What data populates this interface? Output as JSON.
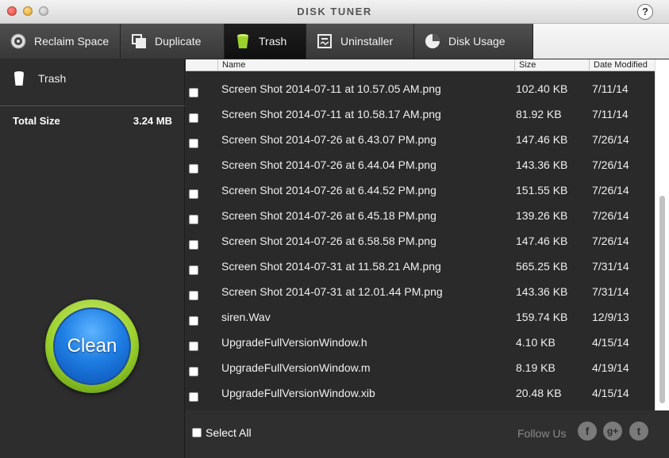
{
  "window": {
    "title": "DISK TUNER",
    "help_label": "?"
  },
  "tabs": [
    {
      "label": "Reclaim Space",
      "icon": "reclaim-icon"
    },
    {
      "label": "Duplicate",
      "icon": "duplicate-icon"
    },
    {
      "label": "Trash",
      "icon": "trash-icon",
      "active": true
    },
    {
      "label": "Uninstaller",
      "icon": "uninstaller-icon"
    },
    {
      "label": "Disk Usage",
      "icon": "disk-usage-icon"
    }
  ],
  "sidebar": {
    "trash_label": "Trash",
    "total_label": "Total Size",
    "total_value": "3.24 MB",
    "clean_label": "Clean"
  },
  "list": {
    "columns": {
      "name": "Name",
      "size": "Size",
      "date": "Date Modified"
    },
    "rows": [
      {
        "name": "Screen Shot 2014-07-11 at 10.57.05 AM.png",
        "size": "102.40 KB",
        "date": "7/11/14"
      },
      {
        "name": "Screen Shot 2014-07-11 at 10.58.17 AM.png",
        "size": "81.92 KB",
        "date": "7/11/14"
      },
      {
        "name": "Screen Shot 2014-07-26 at 6.43.07 PM.png",
        "size": "147.46 KB",
        "date": "7/26/14"
      },
      {
        "name": "Screen Shot 2014-07-26 at 6.44.04 PM.png",
        "size": "143.36 KB",
        "date": "7/26/14"
      },
      {
        "name": "Screen Shot 2014-07-26 at 6.44.52 PM.png",
        "size": "151.55 KB",
        "date": "7/26/14"
      },
      {
        "name": "Screen Shot 2014-07-26 at 6.45.18 PM.png",
        "size": "139.26 KB",
        "date": "7/26/14"
      },
      {
        "name": "Screen Shot 2014-07-26 at 6.58.58 PM.png",
        "size": "147.46 KB",
        "date": "7/26/14"
      },
      {
        "name": "Screen Shot 2014-07-31 at 11.58.21 AM.png",
        "size": "565.25 KB",
        "date": "7/31/14"
      },
      {
        "name": "Screen Shot 2014-07-31 at 12.01.44 PM.png",
        "size": "143.36 KB",
        "date": "7/31/14"
      },
      {
        "name": "siren.Wav",
        "size": "159.74 KB",
        "date": "12/9/13"
      },
      {
        "name": "UpgradeFullVersionWindow.h",
        "size": "4.10 KB",
        "date": "4/15/14"
      },
      {
        "name": "UpgradeFullVersionWindow.m",
        "size": "8.19 KB",
        "date": "4/19/14"
      },
      {
        "name": "UpgradeFullVersionWindow.xib",
        "size": "20.48 KB",
        "date": "4/15/14"
      }
    ]
  },
  "footer": {
    "select_all_label": "Select All",
    "follow_label": "Follow Us",
    "social": [
      {
        "label": "f",
        "icon": "facebook-icon"
      },
      {
        "label": "g+",
        "icon": "google-plus-icon"
      },
      {
        "label": "t",
        "icon": "twitter-icon"
      }
    ]
  },
  "colors": {
    "accent_green": "#9cd12c",
    "clean_blue": "#1f7fe4",
    "background": "#2b2b2b"
  }
}
